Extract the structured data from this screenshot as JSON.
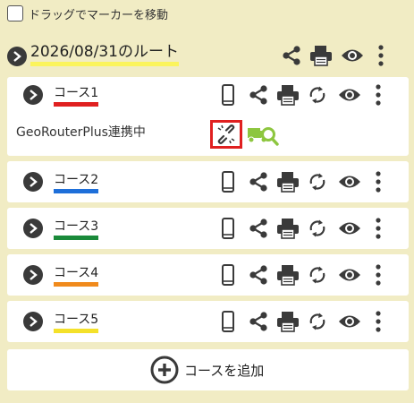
{
  "drag": {
    "label": "ドラッグでマーカーを移動",
    "checked": false
  },
  "route": {
    "title": "2026/08/31のルート",
    "underline": "#fbf45c"
  },
  "courses": [
    {
      "label": "コース1",
      "color": "#e02020",
      "expanded": true
    },
    {
      "label": "コース2",
      "color": "#1e6fd9"
    },
    {
      "label": "コース3",
      "color": "#1a8a3a"
    },
    {
      "label": "コース4",
      "color": "#f08a1c"
    },
    {
      "label": "コース5",
      "color": "#f4e12a"
    }
  ],
  "geo": {
    "label": "GeoRouterPlus連携中"
  },
  "add": {
    "label": "コースを追加"
  },
  "colors": {
    "background": "#f1ecc4",
    "panel": "#ffffff",
    "icon": "#3a3a3a",
    "truck": "#8dc63f",
    "highlight": "#e02020"
  }
}
